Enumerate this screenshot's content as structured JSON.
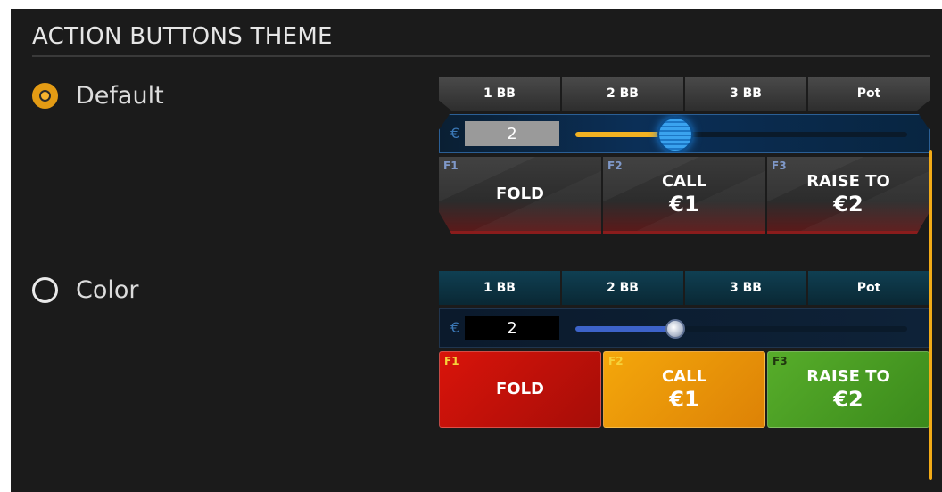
{
  "section_title": "ACTION BUTTONS THEME",
  "themes": [
    {
      "label": "Default",
      "selected": true,
      "bet_presets": [
        "1 BB",
        "2 BB",
        "3 BB",
        "Pot"
      ],
      "currency_symbol": "€",
      "amount": "2",
      "slider_fraction": 0.3,
      "actions": [
        {
          "key": "F1",
          "line1": "FOLD",
          "line2": ""
        },
        {
          "key": "F2",
          "line1": "CALL",
          "line2": "€1"
        },
        {
          "key": "F3",
          "line1": "RAISE TO",
          "line2": "€2"
        }
      ]
    },
    {
      "label": "Color",
      "selected": false,
      "bet_presets": [
        "1 BB",
        "2 BB",
        "3 BB",
        "Pot"
      ],
      "currency_symbol": "€",
      "amount": "2",
      "slider_fraction": 0.3,
      "actions": [
        {
          "key": "F1",
          "line1": "FOLD",
          "line2": ""
        },
        {
          "key": "F2",
          "line1": "CALL",
          "line2": "€1"
        },
        {
          "key": "F3",
          "line1": "RAISE TO",
          "line2": "€2"
        }
      ]
    }
  ],
  "colors": {
    "accent": "#f3ab17",
    "fold": "#d9140a",
    "call": "#f4a70b",
    "raise": "#57ad2a"
  }
}
